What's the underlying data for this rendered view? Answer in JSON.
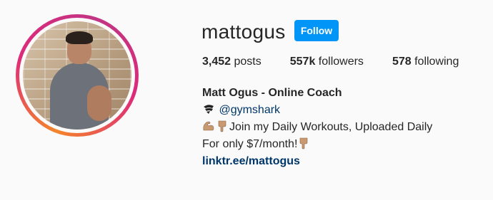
{
  "profile": {
    "username": "mattogus",
    "follow_label": "Follow",
    "stats": {
      "posts_count": "3,452",
      "posts_label": "posts",
      "followers_count": "557k",
      "followers_label": "followers",
      "following_count": "578",
      "following_label": "following"
    },
    "bio": {
      "name": "Matt Ogus - Online Coach",
      "mention": "@gymshark",
      "line2_text": "Join my Daily Workouts, Uploaded Daily",
      "line3_text": "For only $7/month!",
      "link": "linktr.ee/mattogus"
    },
    "icons": {
      "mention_icon": "gymshark-logo-icon",
      "muscle_icon": "flexed-biceps-icon",
      "point_icon": "pointing-down-icon"
    },
    "colors": {
      "follow_button": "#0095f6",
      "link": "#00376b",
      "text": "#262626",
      "background": "#fafafa"
    }
  }
}
